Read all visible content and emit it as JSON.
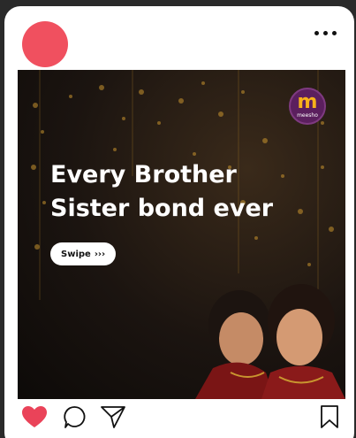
{
  "colors": {
    "avatar": "#f0505f",
    "like": "#ea4359",
    "card_bg": "#ffffff",
    "page_bg": "#2a2a2a"
  },
  "header": {
    "avatar_icon": "profile-avatar",
    "more_icon": "more-options-icon"
  },
  "post": {
    "brand": {
      "mark": "m",
      "name": "meesho"
    },
    "headline": {
      "line1": "Every Brother",
      "line2": "Sister bond ever"
    },
    "swipe_label": "Swipe",
    "swipe_arrows": "›››"
  },
  "actions": {
    "icons": [
      "heart-icon",
      "comment-icon",
      "share-icon",
      "bookmark-icon"
    ]
  }
}
